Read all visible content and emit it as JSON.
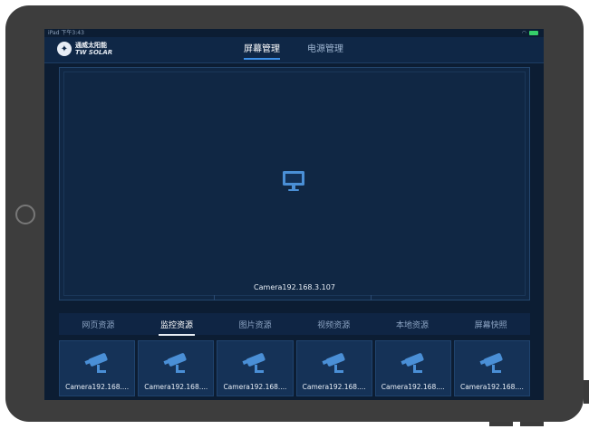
{
  "status": {
    "left": "iPad  下午3:43"
  },
  "header": {
    "logo_cn": "通威太阳能",
    "logo_en": "TW SOLAR",
    "tabs": [
      {
        "label": "屏幕管理",
        "active": true
      },
      {
        "label": "电源管理",
        "active": false
      }
    ]
  },
  "preview": {
    "icon": "monitor-icon",
    "caption": "Camera192.168.3.107"
  },
  "source_tabs": [
    {
      "label": "网页资源",
      "active": false
    },
    {
      "label": "监控资源",
      "active": true
    },
    {
      "label": "图片资源",
      "active": false
    },
    {
      "label": "视频资源",
      "active": false
    },
    {
      "label": "本地资源",
      "active": false
    },
    {
      "label": "屏幕快照",
      "active": false
    }
  ],
  "cameras": [
    {
      "icon": "camera-icon",
      "label": "Camera192.168...."
    },
    {
      "icon": "camera-icon",
      "label": "Camera192.168...."
    },
    {
      "icon": "camera-icon",
      "label": "Camera192.168...."
    },
    {
      "icon": "camera-icon",
      "label": "Camera192.168...."
    },
    {
      "icon": "camera-icon",
      "label": "Camera192.168...."
    },
    {
      "icon": "camera-icon",
      "label": "Camera192.168...."
    }
  ],
  "colors": {
    "screen_bg": "#0c1d33",
    "topbar_bg": "#0f2746",
    "accent_blue": "#4a8fd6",
    "battery_green": "#36d06a"
  }
}
